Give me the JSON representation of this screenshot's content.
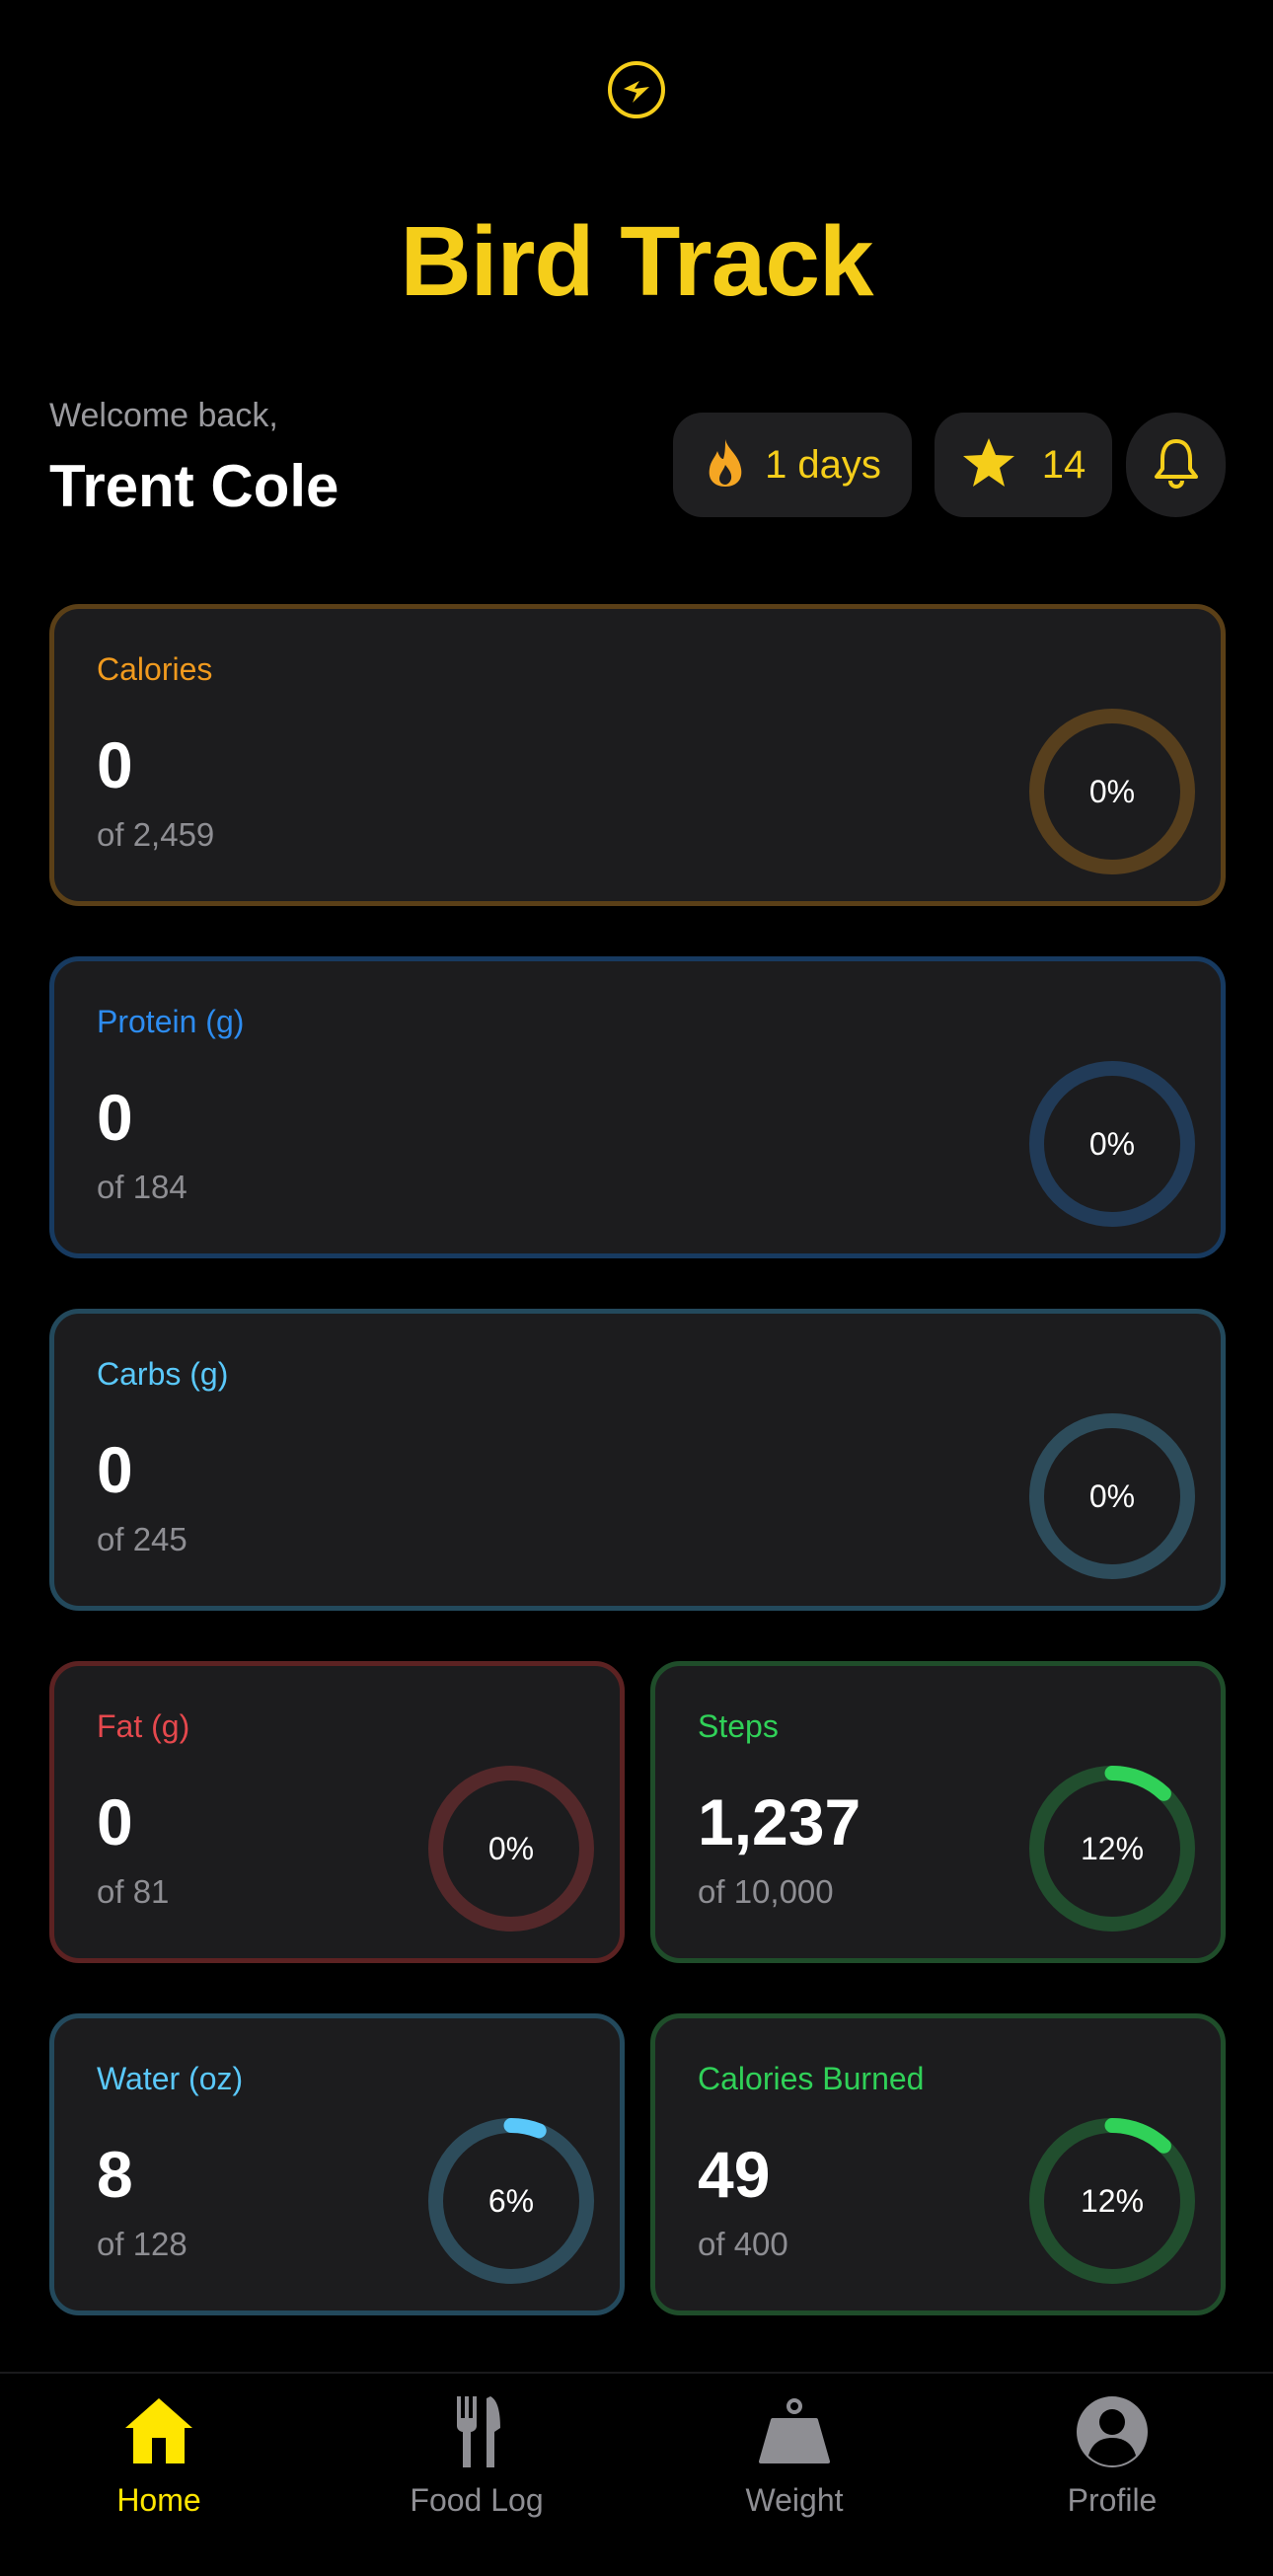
{
  "app": {
    "title": "Bird Track",
    "logo_icon": "bird-bolt-icon"
  },
  "header": {
    "welcome": "Welcome back,",
    "user_name": "Trent Cole",
    "streak": {
      "icon": "flame-icon",
      "label": "1 days"
    },
    "points": {
      "icon": "star-icon",
      "label": "14"
    },
    "notifications": {
      "icon": "bell-icon"
    }
  },
  "cards": {
    "calories": {
      "label": "Calories",
      "value": "0",
      "goal": "of 2,459",
      "percent_label": "0%",
      "progress": 0,
      "color": "#F09A1E"
    },
    "protein": {
      "label": "Protein (g)",
      "value": "0",
      "goal": "of 184",
      "percent_label": "0%",
      "progress": 0,
      "color": "#2D8CF0"
    },
    "carbs": {
      "label": "Carbs (g)",
      "value": "0",
      "goal": "of 245",
      "percent_label": "0%",
      "progress": 0,
      "color": "#5AC8FA"
    },
    "fat": {
      "label": "Fat (g)",
      "value": "0",
      "goal": "of 81",
      "percent_label": "0%",
      "progress": 0,
      "color": "#E5484D"
    },
    "steps": {
      "label": "Steps",
      "value": "1,237",
      "goal": "of 10,000",
      "percent_label": "12%",
      "progress": 0.12,
      "color": "#30D158"
    },
    "water": {
      "label": "Water (oz)",
      "value": "8",
      "goal": "of 128",
      "percent_label": "6%",
      "progress": 0.06,
      "color": "#5AC8FA"
    },
    "burned": {
      "label": "Calories Burned",
      "value": "49",
      "goal": "of 400",
      "percent_label": "12%",
      "progress": 0.12,
      "color": "#30D158"
    }
  },
  "tabs": [
    {
      "label": "Home",
      "icon": "home-icon",
      "active": true
    },
    {
      "label": "Food Log",
      "icon": "fork-knife-icon",
      "active": false
    },
    {
      "label": "Weight",
      "icon": "kettlebell-icon",
      "active": false
    },
    {
      "label": "Profile",
      "icon": "person-icon",
      "active": false
    }
  ],
  "colors": {
    "accent": "#F5CE1A",
    "active_tab": "#FFE600",
    "inactive_tab": "#8e8e93",
    "flame": "#F5A623"
  }
}
